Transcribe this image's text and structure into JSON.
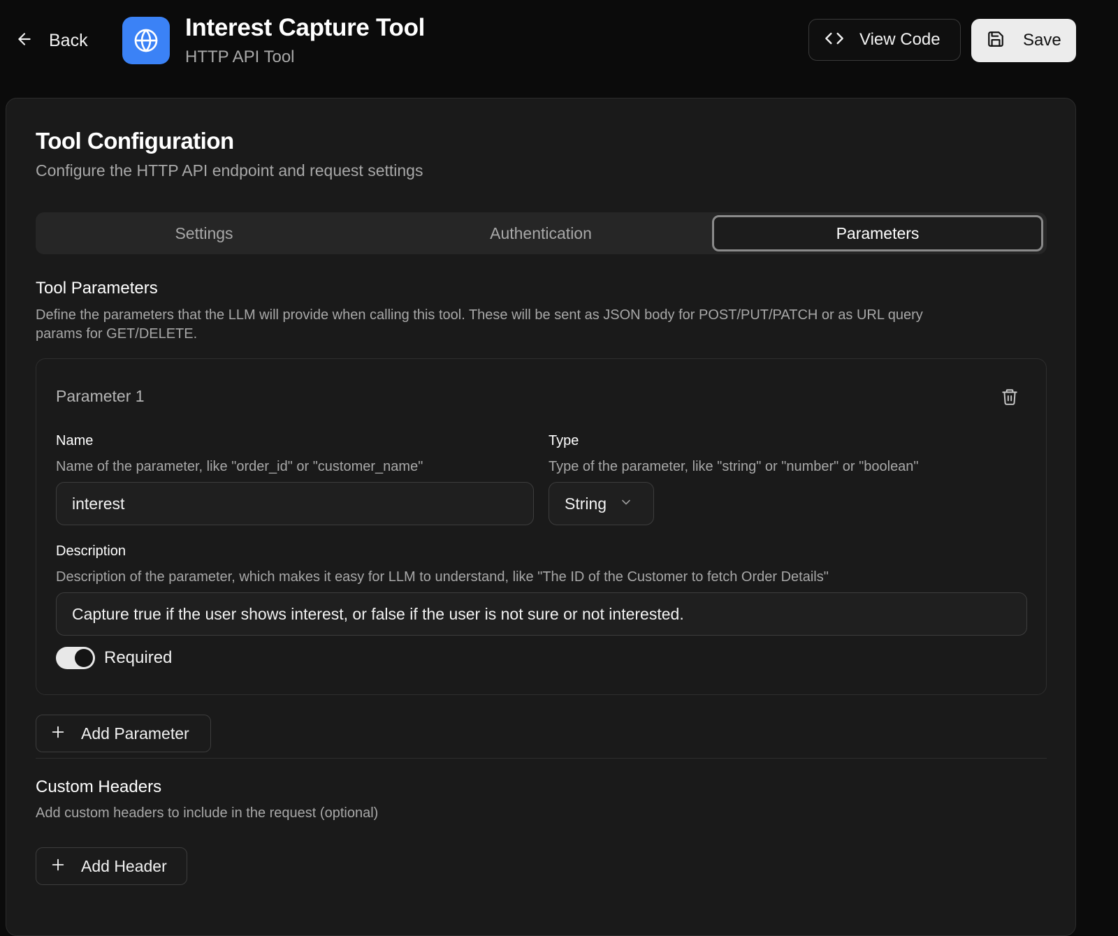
{
  "header": {
    "back_label": "Back",
    "title": "Interest Capture Tool",
    "subtitle": "HTTP API Tool",
    "view_code_label": "View Code",
    "save_label": "Save",
    "app_icon": "globe-icon"
  },
  "card": {
    "title": "Tool Configuration",
    "description": "Configure the HTTP API endpoint and request settings"
  },
  "tabs": [
    {
      "label": "Settings",
      "active": false
    },
    {
      "label": "Authentication",
      "active": false
    },
    {
      "label": "Parameters",
      "active": true
    }
  ],
  "tool_parameters": {
    "title": "Tool Parameters",
    "description_line1": "Define the parameters that the LLM will provide when calling this tool. These will be sent as JSON body for POST/PUT/PATCH or as URL query",
    "description_line2": "params for GET/DELETE.",
    "params": [
      {
        "title": "Parameter 1",
        "name_label": "Name",
        "name_hint": "Name of the parameter, like \"order_id\" or \"customer_name\"",
        "name_value": "interest",
        "type_label": "Type",
        "type_hint": "Type of the parameter, like \"string\" or \"number\" or \"boolean\"",
        "type_value": "String",
        "description_label": "Description",
        "description_hint": "Description of the parameter, which makes it easy for LLM to understand, like \"The ID of the Customer to fetch Order Details\"",
        "description_value": "Capture true if the user shows interest, or false if the user is not sure or not interested.",
        "required_label": "Required",
        "required": true
      }
    ],
    "add_label": "Add Parameter"
  },
  "custom_headers": {
    "title": "Custom Headers",
    "description": "Add custom headers to include in the request (optional)",
    "add_label": "Add Header"
  },
  "colors": {
    "background": "#0b0b0b",
    "card": "#1a1a1a",
    "accent": "#3b82f6"
  }
}
